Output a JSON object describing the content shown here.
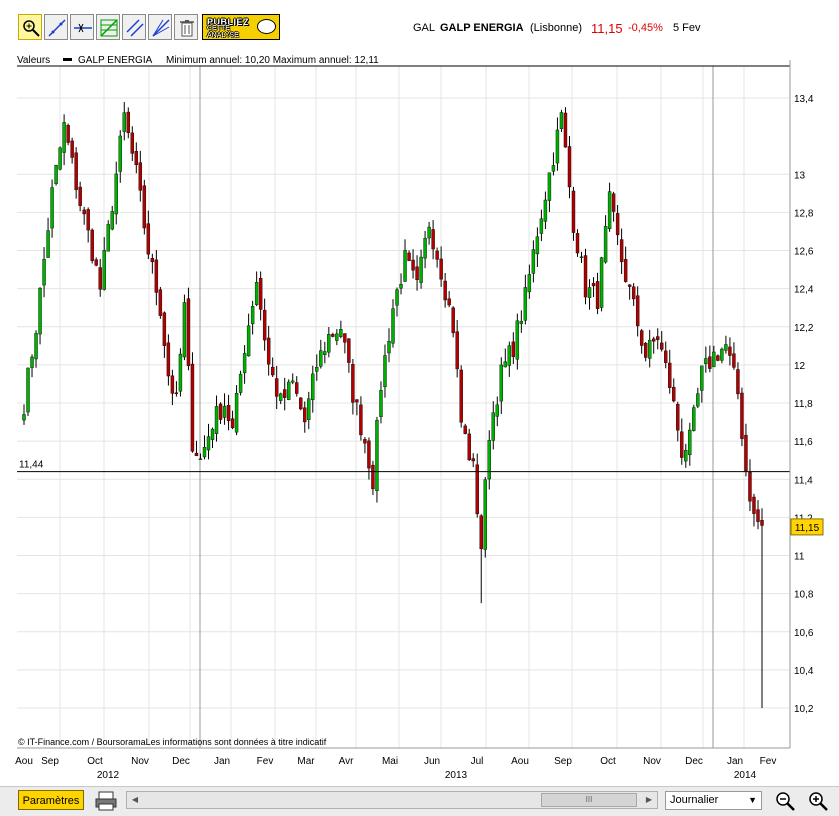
{
  "toolbar": {
    "tools": [
      "zoom-in-tool-icon",
      "trend-line-tool-icon",
      "horizontal-line-tool-icon",
      "fibonacci-tool-icon",
      "channel-tool-icon",
      "fan-tool-icon",
      "trash-icon"
    ],
    "publiez_line1": "PUBLIEZ",
    "publiez_line2a": "CETTE",
    "publiez_line2b": "ANALYSE"
  },
  "quote": {
    "ticker": "GAL",
    "name": "GALP ENERGIA",
    "market": "(Lisbonne)",
    "price": "11,15",
    "change": "-0,45%",
    "date": "5 Fev",
    "price_color": "#e00000"
  },
  "chart_data": {
    "type": "candlestick",
    "legend_prefix": "Valeurs",
    "series_name": "GALP ENERGIA",
    "annual_stats": "Minimum annuel: 10,20 Maximum annuel: 12,11",
    "ylim": [
      10.05,
      13.6
    ],
    "y_ticks": [
      "13,4",
      "13",
      "12,8",
      "12,6",
      "12,4",
      "12,2",
      "12",
      "11,8",
      "11,6",
      "11,4",
      "11,2",
      "11",
      "10,8",
      "10,6",
      "10,4",
      "10,2"
    ],
    "y_tick_values": [
      13.4,
      13.0,
      12.8,
      12.6,
      12.4,
      12.2,
      12.0,
      11.8,
      11.6,
      11.4,
      11.2,
      11.0,
      10.8,
      10.6,
      10.4,
      10.2
    ],
    "x_months": [
      "Aou",
      "Sep",
      "Oct",
      "Nov",
      "Dec",
      "Jan",
      "Fev",
      "Mar",
      "Avr",
      "Mai",
      "Jun",
      "Jul",
      "Aou",
      "Sep",
      "Oct",
      "Nov",
      "Dec",
      "Jan",
      "Fev"
    ],
    "x_years": [
      "2012",
      "2013",
      "2014"
    ],
    "reference_line": {
      "value": 11.44,
      "label": "11,44"
    },
    "last_value": {
      "value": 11.15,
      "label": "11,15"
    },
    "close_anchors": [
      [
        0,
        11.8
      ],
      [
        3,
        12.2
      ],
      [
        7,
        12.9
      ],
      [
        10,
        13.25
      ],
      [
        14,
        12.85
      ],
      [
        17,
        12.6
      ],
      [
        19,
        12.4
      ],
      [
        22,
        12.85
      ],
      [
        25,
        13.3
      ],
      [
        28,
        13.0
      ],
      [
        31,
        12.6
      ],
      [
        34,
        12.3
      ],
      [
        36,
        11.95
      ],
      [
        38,
        11.8
      ],
      [
        40,
        12.3
      ],
      [
        42,
        11.6
      ],
      [
        44,
        11.5
      ],
      [
        47,
        11.7
      ],
      [
        50,
        11.8
      ],
      [
        52,
        11.65
      ],
      [
        55,
        12.1
      ],
      [
        58,
        12.45
      ],
      [
        61,
        12.0
      ],
      [
        64,
        11.8
      ],
      [
        67,
        11.9
      ],
      [
        70,
        11.7
      ],
      [
        73,
        12.0
      ],
      [
        76,
        12.15
      ],
      [
        79,
        12.2
      ],
      [
        82,
        11.85
      ],
      [
        85,
        11.6
      ],
      [
        87,
        11.4
      ],
      [
        89,
        11.9
      ],
      [
        92,
        12.3
      ],
      [
        95,
        12.55
      ],
      [
        98,
        12.4
      ],
      [
        101,
        12.75
      ],
      [
        104,
        12.5
      ],
      [
        107,
        12.2
      ],
      [
        109,
        11.7
      ],
      [
        112,
        11.45
      ],
      [
        114,
        11.05
      ],
      [
        116,
        11.65
      ],
      [
        119,
        11.95
      ],
      [
        122,
        12.1
      ],
      [
        125,
        12.35
      ],
      [
        128,
        12.7
      ],
      [
        131,
        13.0
      ],
      [
        134,
        13.3
      ],
      [
        137,
        12.75
      ],
      [
        140,
        12.4
      ],
      [
        143,
        12.35
      ],
      [
        146,
        12.85
      ],
      [
        149,
        12.55
      ],
      [
        152,
        12.3
      ],
      [
        155,
        12.05
      ],
      [
        158,
        12.15
      ],
      [
        161,
        11.9
      ],
      [
        164,
        11.55
      ],
      [
        166,
        11.6
      ],
      [
        169,
        11.95
      ],
      [
        172,
        12.05
      ],
      [
        175,
        12.1
      ],
      [
        178,
        11.85
      ],
      [
        180,
        11.45
      ],
      [
        182,
        11.2
      ],
      [
        184,
        11.15
      ]
    ],
    "close_anchor_units": "[trading-day index, close price]"
  },
  "footer": {
    "params_label": "Paramètres",
    "period_select": "Journalier",
    "scroll_grip": "III",
    "copyright": "© IT-Finance.com / BoursoramaLes informations sont données à titre indicatif"
  },
  "colors": {
    "up_candle": "#00b000",
    "down_candle": "#b00000",
    "grid": "#e4e4e4",
    "last_badge_bg": "#ffd400",
    "publiez_bg": "#f5d000"
  }
}
